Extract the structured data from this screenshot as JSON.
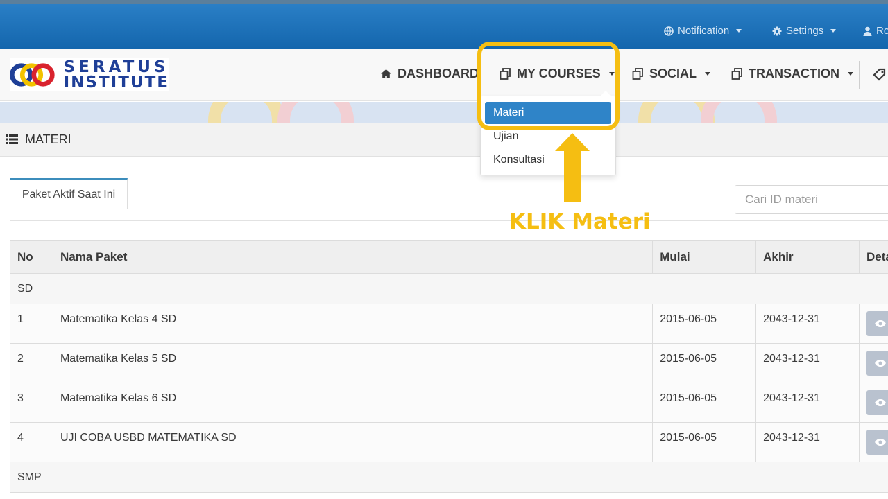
{
  "topbar": {
    "notification": "Notification",
    "settings": "Settings",
    "user": "Ro"
  },
  "logo": {
    "line1": "SERATUS",
    "line2": "INSTITUTE"
  },
  "nav": {
    "dashboard": "DASHBOARD",
    "my_courses": "MY COURSES",
    "social": "SOCIAL",
    "transaction": "TRANSACTION"
  },
  "dropdown": {
    "items": [
      "Materi",
      "Ujian",
      "Konsultasi"
    ],
    "active": "Materi"
  },
  "section": {
    "title": "MATERI"
  },
  "tab": {
    "label": "Paket Aktif Saat Ini"
  },
  "search": {
    "placeholder": "Cari ID materi"
  },
  "table": {
    "headers": [
      "No",
      "Nama Paket",
      "Mulai",
      "Akhir",
      "Deta"
    ],
    "groups": [
      {
        "name": "SD",
        "rows": [
          {
            "no": "1",
            "nama": "Matematika Kelas 4 SD",
            "mulai": "2015-06-05",
            "akhir": "2043-12-31"
          },
          {
            "no": "2",
            "nama": "Matematika Kelas 5 SD",
            "mulai": "2015-06-05",
            "akhir": "2043-12-31"
          },
          {
            "no": "3",
            "nama": "Matematika Kelas 6 SD",
            "mulai": "2015-06-05",
            "akhir": "2043-12-31"
          },
          {
            "no": "4",
            "nama": "UJI COBA USBD MATEMATIKA SD",
            "mulai": "2015-06-05",
            "akhir": "2043-12-31"
          }
        ]
      },
      {
        "name": "SMP",
        "rows": []
      }
    ]
  },
  "annotation": {
    "text": "KLIK Materi",
    "color": "#f5be12"
  },
  "colors": {
    "topbar": "#1a6fb5",
    "accent": "#2f84c8",
    "highlight": "#f5be12",
    "logo_blue": "#1f3f97"
  }
}
